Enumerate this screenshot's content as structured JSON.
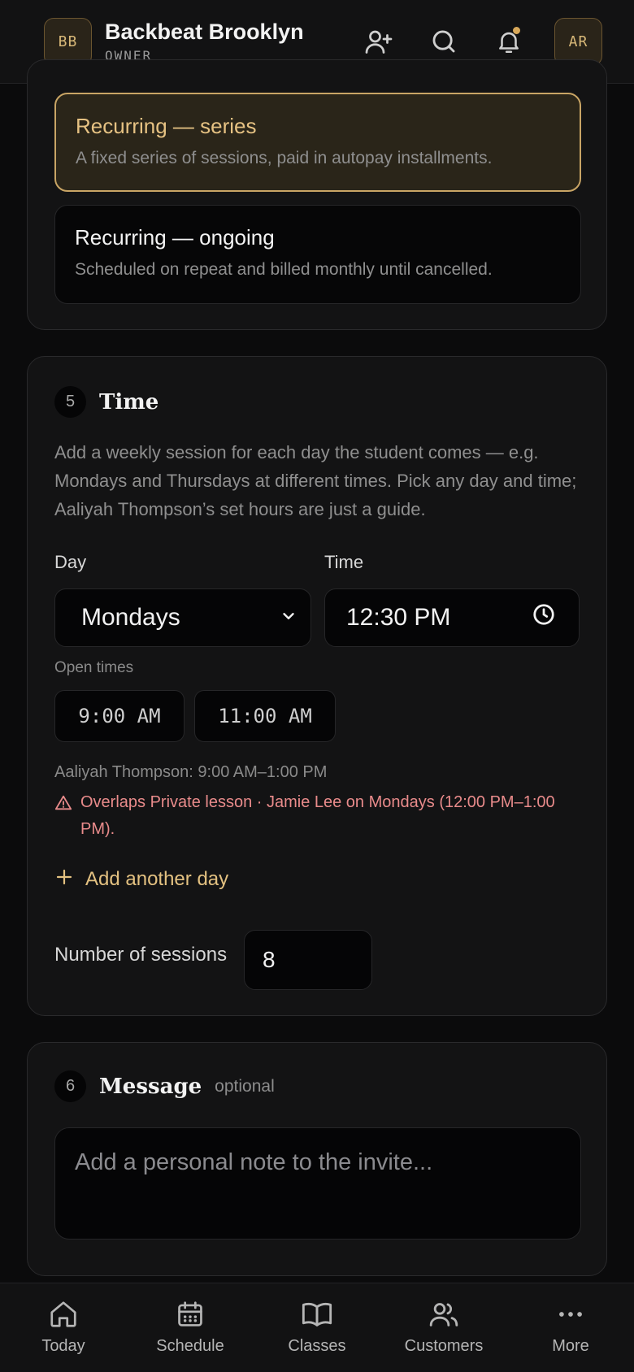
{
  "header": {
    "badge": "BB",
    "brand_name": "Backbeat Brooklyn",
    "role": "OWNER",
    "avatar": "AR",
    "icons": [
      "add-user-icon",
      "search-icon",
      "bell-icon"
    ]
  },
  "booking_type": {
    "options": [
      {
        "title": "Recurring — series",
        "description": "A fixed series of sessions, paid in autopay installments.",
        "selected": true
      },
      {
        "title": "Recurring — ongoing",
        "description": "Scheduled on repeat and billed monthly until cancelled.",
        "selected": false
      }
    ]
  },
  "time_section": {
    "number": "5",
    "title": "Time",
    "help": "Add a weekly session for each day the student comes — e.g. Mondays and Thursdays at different times. Pick any day and time; Aaliyah Thompson’s set hours are just a guide.",
    "day_label": "Day",
    "day_value": "Mondays",
    "time_label": "Time",
    "time_value": "12:30 PM",
    "open_times_label": "Open times",
    "open_times": [
      "9:00 AM",
      "11:00 AM"
    ],
    "instructor_hours": "Aaliyah Thompson: 9:00 AM–1:00 PM",
    "warning": "Overlaps Private lesson · Jamie Lee on Mondays (12:00 PM–1:00 PM).",
    "add_day_label": "Add another day",
    "sessions_label": "Number of sessions",
    "sessions_value": "8"
  },
  "message_section": {
    "number": "6",
    "title": "Message",
    "optional_label": "optional",
    "placeholder": "Add a personal note to the invite..."
  },
  "bottom_nav": {
    "items": [
      {
        "label": "Today",
        "icon": "home-icon"
      },
      {
        "label": "Schedule",
        "icon": "calendar-icon"
      },
      {
        "label": "Classes",
        "icon": "book-icon"
      },
      {
        "label": "Customers",
        "icon": "users-icon"
      },
      {
        "label": "More",
        "icon": "more-icon"
      }
    ]
  },
  "colors": {
    "accent": "#e3c181",
    "warning": "#e98b8b",
    "background": "#0b0b0c"
  }
}
